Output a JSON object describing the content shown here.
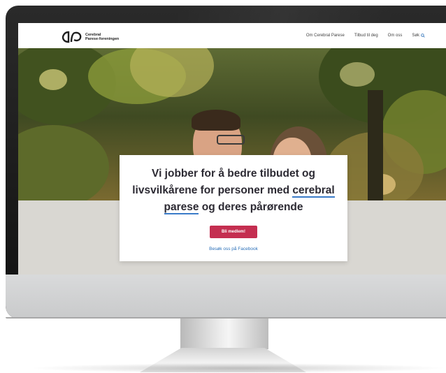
{
  "site": {
    "logo_line1": "Cerebral",
    "logo_line2": "Parese-foreningen",
    "nav": [
      "Om Cerebral Parese",
      "Tilbud til deg",
      "Om oss",
      "Søk"
    ]
  },
  "hero": {
    "heading_part1": "Vi jobber for å bedre tilbudet og livsvilkårene for personer med ",
    "heading_link": "cerebral parese",
    "heading_part2": " og deres pårørende",
    "button_label": "Bli medlem!",
    "facebook_link": "Besøk oss på Facebook"
  },
  "colors": {
    "accent": "#c42e50",
    "link": "#2a6fb8",
    "content_bg": "#d9d7d2"
  },
  "icons": [
    "heart-logo-icon",
    "search-icon"
  ]
}
